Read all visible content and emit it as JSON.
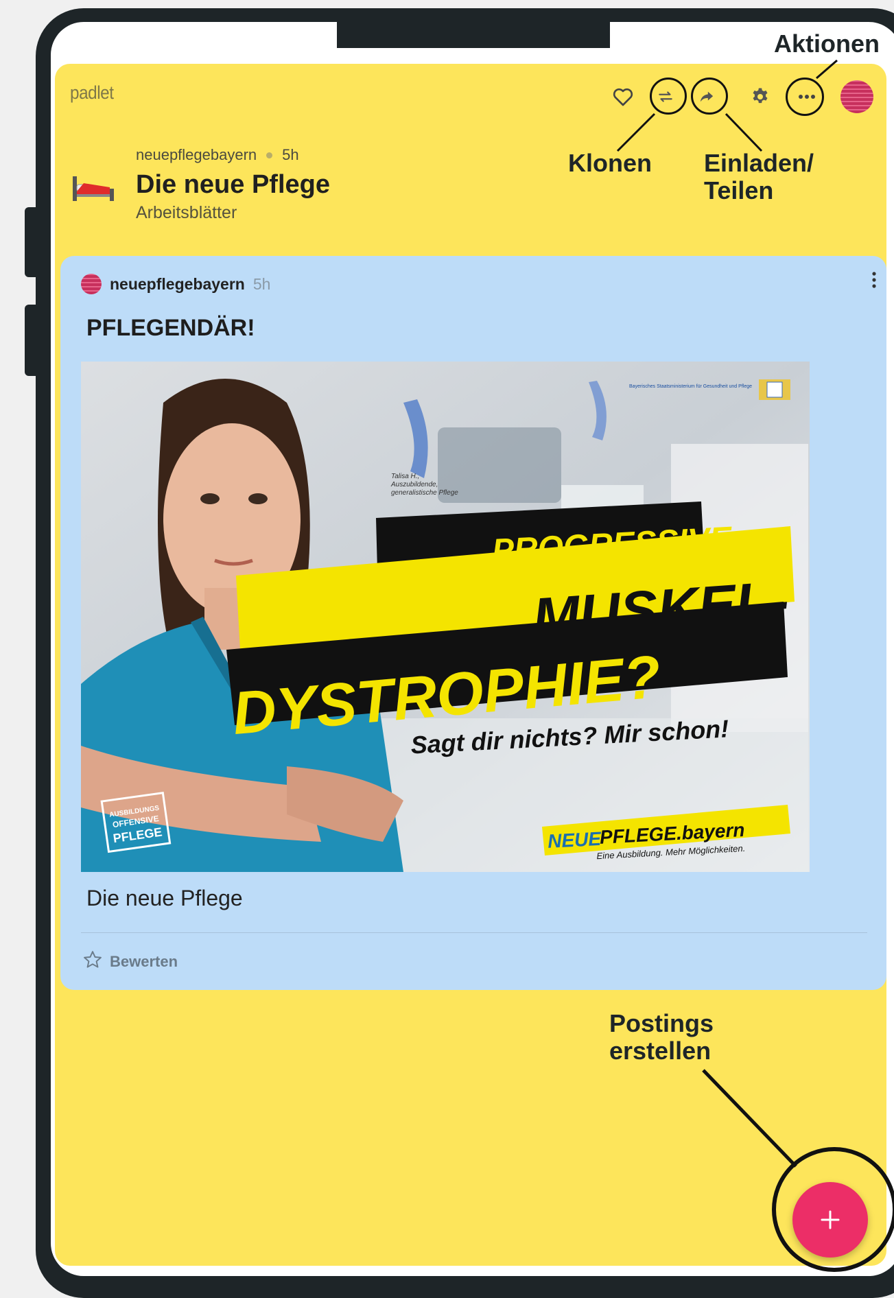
{
  "padlet": {
    "brand": "padlet",
    "author": "neuepflegebayern",
    "time": "5h",
    "title": "Die neue Pflege",
    "subtitle": "Arbeitsblätter"
  },
  "post": {
    "author": "neuepflegebayern",
    "time": "5h",
    "title": "PFLEGENDÄR!",
    "caption": "Die neue Pflege",
    "rate_label": "Bewerten",
    "image": {
      "ministry": "Bayerisches Staatsministerium für Gesundheit und Pflege",
      "person_line1": "Talisa H.,",
      "person_line2": "Auszubildende,",
      "person_line3": "generalistische Pflege",
      "headline1": "PROGRESSIVE",
      "headline2": "MUSKEL-",
      "headline3": "DYSTROPHIE?",
      "tagline": "Sagt dir nichts? Mir schon!",
      "brand_neue": "NEUE",
      "brand_pflege": "PFLEGE.bayern",
      "brand_slogan": "Eine Ausbildung. Mehr Möglichkeiten.",
      "stamp1": "AUSBILDUNGS",
      "stamp2": "OFFENSIVE",
      "stamp3": "PFLEGE"
    }
  },
  "annotations": {
    "actions": "Aktionen",
    "clone": "Klonen",
    "share_line1": "Einladen/",
    "share_line2": "Teilen",
    "create_line1": "Postings",
    "create_line2": "erstellen"
  },
  "icons": {
    "like": "heart-icon",
    "clone": "remake-icon",
    "share": "share-arrow-icon",
    "settings": "gear-icon",
    "more": "more-icon",
    "add": "plus-icon",
    "rate": "star-icon"
  },
  "colors": {
    "wall": "#fde55b",
    "card": "#bddcf8",
    "fab": "#ec2e67",
    "device": "#1e2528"
  }
}
